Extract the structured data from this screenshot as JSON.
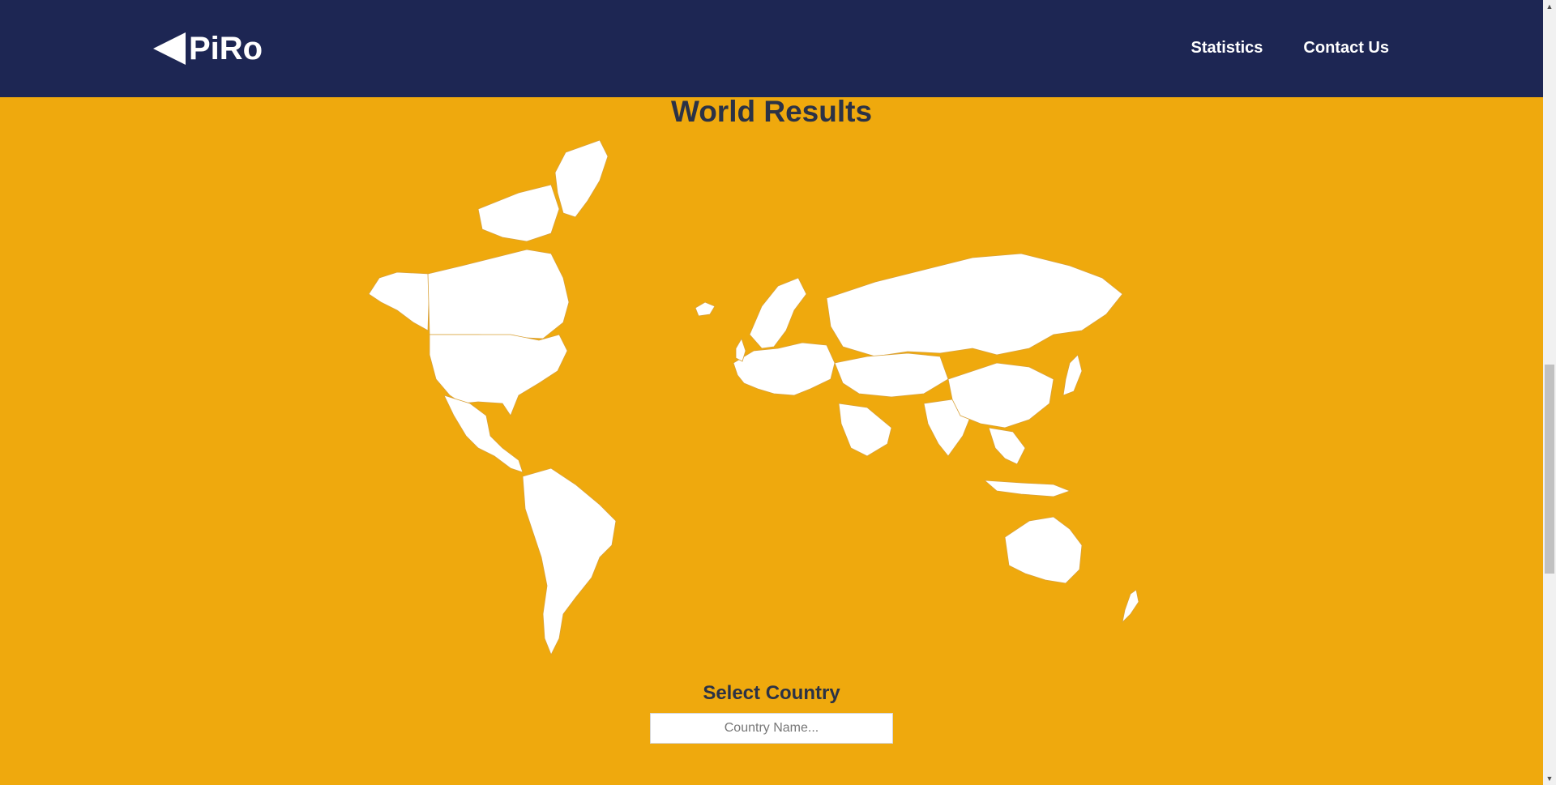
{
  "header": {
    "logo_text": "PiRo",
    "nav": [
      {
        "label": "Statistics"
      },
      {
        "label": "Contact Us"
      }
    ]
  },
  "main": {
    "title": "World Results",
    "select_label": "Select Country",
    "country_input": {
      "placeholder": "Country Name...",
      "value": ""
    }
  },
  "colors": {
    "navbar": "#1d2653",
    "background": "#efa90d",
    "heading": "#2b3246",
    "land": "#ffffff"
  },
  "icons": {
    "logo": "left-triangle-icon"
  }
}
